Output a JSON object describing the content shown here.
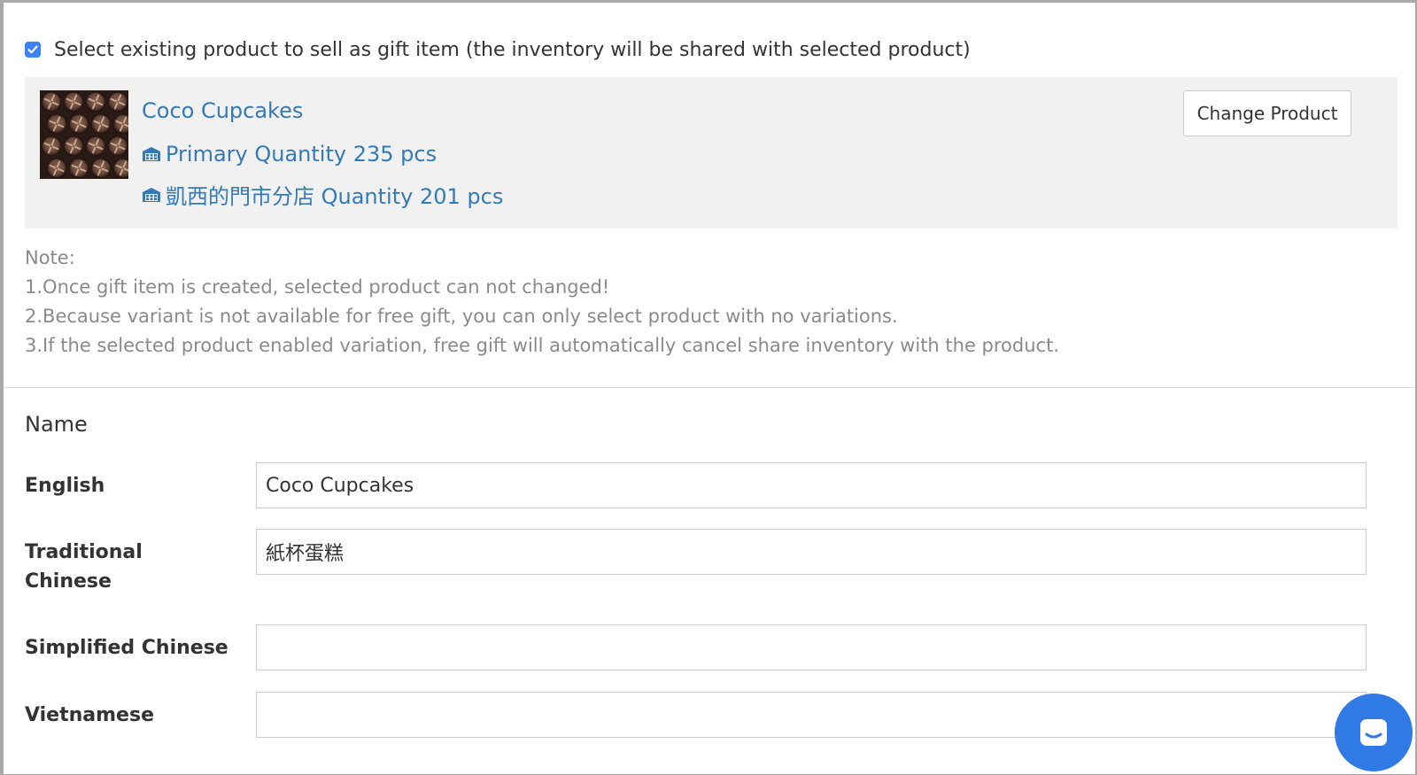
{
  "gift_selection": {
    "checkbox_checked": true,
    "checkbox_label": "Select existing product to sell as gift item (the inventory will be shared with selected product)"
  },
  "product": {
    "name": "Coco Cupcakes",
    "image_icon": "cupcake-thumbnail",
    "inventories": [
      {
        "icon": "warehouse-icon",
        "text": "Primary Quantity 235 pcs"
      },
      {
        "icon": "warehouse-icon",
        "text": "凱西的門市分店 Quantity 201 pcs"
      }
    ],
    "change_button_label": "Change Product"
  },
  "notes": {
    "title": "Note:",
    "lines": [
      "1.Once gift item is created, selected product can not changed!",
      "2.Because variant is not available for free gift, you can only select product with no variations.",
      "3.If the selected product enabled variation, free gift will automatically cancel share inventory with the product."
    ]
  },
  "name_section": {
    "title": "Name",
    "fields": [
      {
        "label": "English",
        "value": "Coco Cupcakes",
        "placeholder": ""
      },
      {
        "label": "Traditional Chinese",
        "value": "紙杯蛋糕",
        "placeholder": ""
      },
      {
        "label": "Simplified Chinese",
        "value": "",
        "placeholder": ""
      },
      {
        "label": "Vietnamese",
        "value": "",
        "placeholder": ""
      }
    ]
  },
  "chat_widget": {
    "icon": "chat-bubble-icon"
  },
  "colors": {
    "link": "#337ab7",
    "checkbox": "#3b82f6",
    "product_box_bg": "#f1f1f1",
    "note_text": "#8a8a8a",
    "chat_button": "#2f7ae5"
  }
}
